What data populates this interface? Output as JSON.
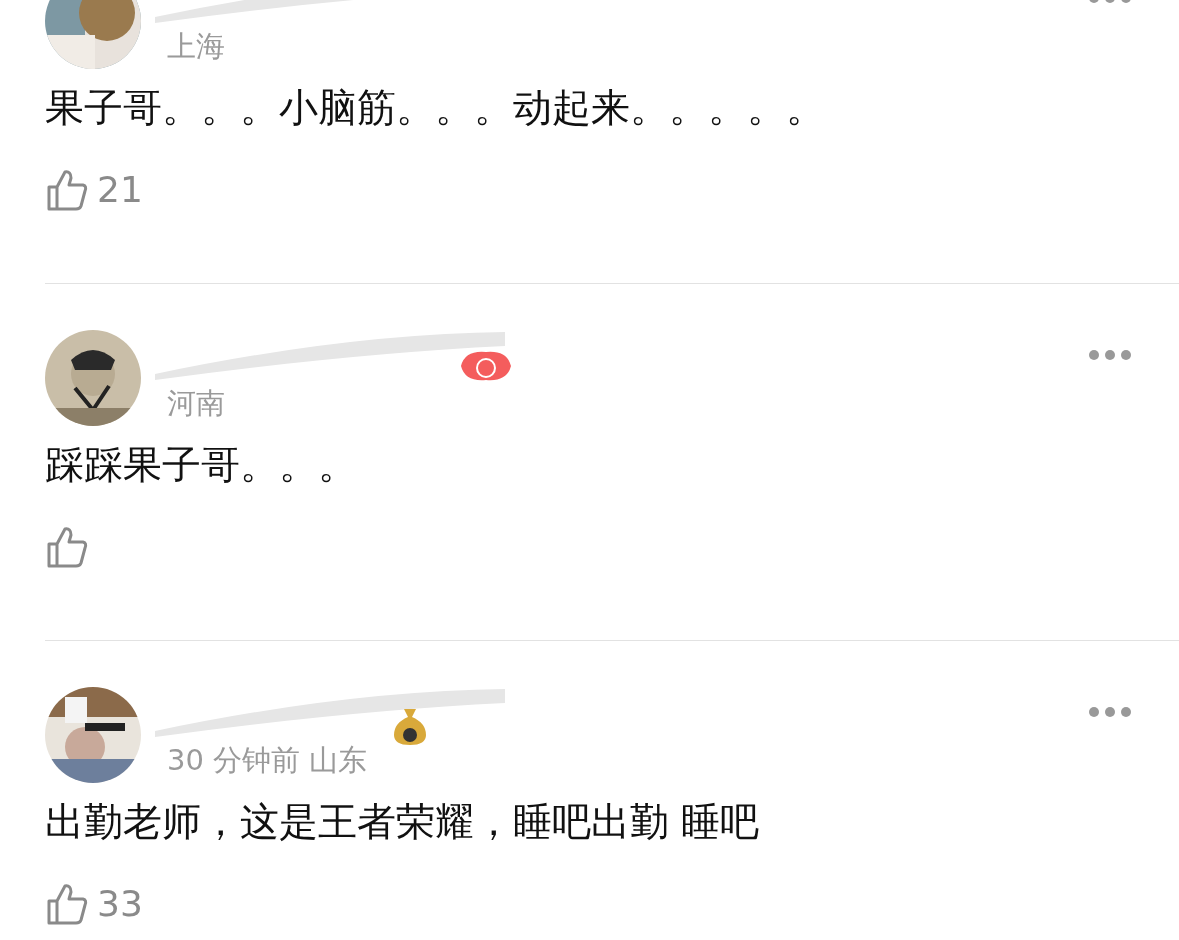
{
  "comments": [
    {
      "location": "上海",
      "text": "果子哥。。。小脑筋。。。动起来。。。。。",
      "likes": "21"
    },
    {
      "badge": {
        "kind": "flower"
      },
      "location": "河南",
      "text": "踩踩果子哥。。。"
    },
    {
      "badge": {
        "kind": "money"
      },
      "time": "30 分钟前",
      "location": "山东",
      "text": "出勤老师，这是王者荣耀，睡吧出勤 睡吧",
      "likes": "33"
    }
  ]
}
